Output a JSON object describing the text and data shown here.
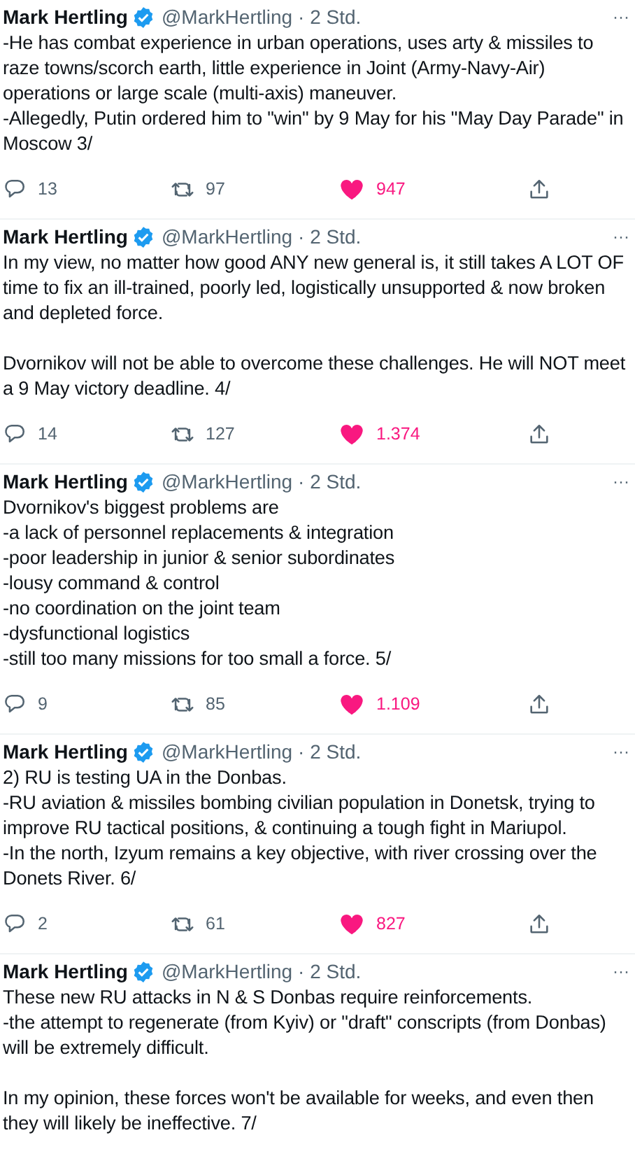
{
  "tweets": [
    {
      "name": "Mark Hertling",
      "verified": true,
      "handle": "@MarkHertling",
      "time": "· 2 Std.",
      "more": "···",
      "text": "-He has combat experience in urban operations, uses arty & missiles to raze towns/scorch earth, little experience in Joint (Army-Navy-Air) operations or large scale (multi-axis) maneuver.\n-Allegedly, Putin ordered him to \"win\" by 9 May for his \"May Day Parade\" in Moscow 3/",
      "replies": "13",
      "retweets": "97",
      "likes": "947",
      "liked": true
    },
    {
      "name": "Mark Hertling",
      "verified": true,
      "handle": "@MarkHertling",
      "time": "· 2 Std.",
      "more": "···",
      "text": "In my view, no matter how good ANY new general is, it still takes A LOT OF time to fix an ill-trained, poorly led, logistically unsupported & now broken and depleted force.\n\nDvornikov will not be able to overcome these challenges.  He will NOT meet a 9 May victory deadline. 4/",
      "replies": "14",
      "retweets": "127",
      "likes": "1.374",
      "liked": true
    },
    {
      "name": "Mark Hertling",
      "verified": true,
      "handle": "@MarkHertling",
      "time": "· 2 Std.",
      "more": "···",
      "text": "Dvornikov's biggest problems are\n-a lack of personnel replacements & integration\n-poor leadership in junior & senior subordinates\n-lousy command & control\n-no coordination on the joint team\n-dysfunctional logistics\n-still too many missions for too small a force. 5/",
      "replies": "9",
      "retweets": "85",
      "likes": "1.109",
      "liked": true
    },
    {
      "name": "Mark Hertling",
      "verified": true,
      "handle": "@MarkHertling",
      "time": "· 2 Std.",
      "more": "···",
      "text": "2) RU is testing UA in the Donbas.\n-RU aviation & missiles bombing civilian population in Donetsk, trying to improve RU tactical positions, & continuing a tough fight in Mariupol.\n-In the north, Izyum remains a key objective, with river crossing over the Donets River. 6/",
      "replies": "2",
      "retweets": "61",
      "likes": "827",
      "liked": true
    },
    {
      "name": "Mark Hertling",
      "verified": true,
      "handle": "@MarkHertling",
      "time": "· 2 Std.",
      "more": "···",
      "text": "These new RU attacks in N & S Donbas require reinforcements.\n-the attempt to regenerate (from Kyiv) or \"draft\" conscripts (from Donbas) will be extremely difficult.\n\nIn my opinion, these forces won't be available for weeks, and even then they will likely be ineffective. 7/"
    }
  ]
}
